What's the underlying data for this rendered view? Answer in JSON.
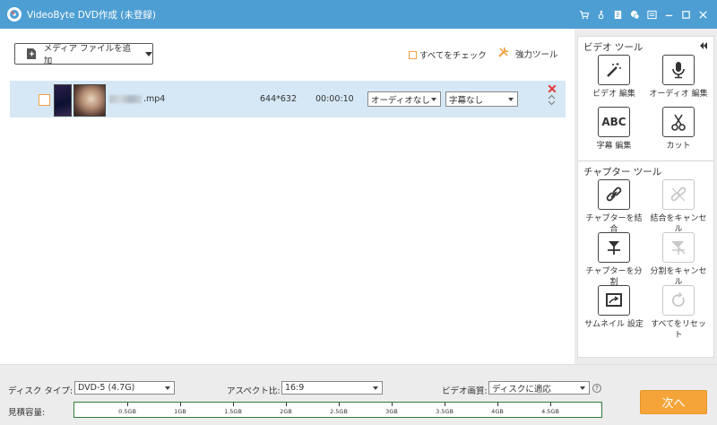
{
  "window": {
    "title": "VideoByte DVD作成 (未登録)",
    "controls": [
      "cart-icon",
      "key-icon",
      "register-icon",
      "feedback-icon",
      "menu-icon",
      "minimize-icon",
      "maximize-icon",
      "close-icon"
    ]
  },
  "toolbar": {
    "add_media_label": "メディア ファイルを追加",
    "check_all_label": "すべてをチェック",
    "power_tools_label": "強力ツール"
  },
  "file": {
    "name_suffix": ".mp4",
    "resolution": "644*632",
    "duration": "00:00:10",
    "audio_track": "オーディオなし",
    "subtitle": "字幕なし"
  },
  "video_tools": {
    "title": "ビデオ ツール",
    "items": [
      {
        "label": "ビデオ 編集",
        "icon": "magic-wand-icon"
      },
      {
        "label": "オーディオ 編集",
        "icon": "microphone-icon"
      },
      {
        "label": "字幕 編集",
        "icon": "abc-icon",
        "icon_text": "ABC"
      },
      {
        "label": "カット",
        "icon": "scissors-icon"
      }
    ]
  },
  "chapter_tools": {
    "title": "チャプター ツール",
    "items": [
      {
        "label": "チャプターを結合",
        "icon": "link-icon",
        "enabled": true
      },
      {
        "label": "結合をキャンセル",
        "icon": "unlink-icon",
        "enabled": false
      },
      {
        "label": "チャプターを分割",
        "icon": "split-icon",
        "enabled": true
      },
      {
        "label": "分割をキャンセル",
        "icon": "cancel-split-icon",
        "enabled": false
      },
      {
        "label": "サムネイル 設定",
        "icon": "thumbnail-icon",
        "enabled": true
      },
      {
        "label": "すべてをリセット",
        "icon": "reset-icon",
        "enabled": false
      }
    ]
  },
  "bottom": {
    "disc_type_label": "ディスク タイプ:",
    "disc_type_value": "DVD-5 (4.7G)",
    "aspect_label": "アスペクト比:",
    "aspect_value": "16:9",
    "quality_label": "ビデオ画質:",
    "quality_value": "ディスクに適応",
    "help_text": "?",
    "capacity_label": "見積容量:",
    "next_label": "次へ",
    "capacity_ticks": [
      "0.5GB",
      "1GB",
      "1.5GB",
      "2GB",
      "2.5GB",
      "3GB",
      "3.5GB",
      "4GB",
      "4.5GB"
    ]
  },
  "colors": {
    "titlebar": "#4d9ed3",
    "accent": "#f5a43a",
    "row_highlight": "#d6e8f6",
    "capacity_border": "#2f7c3a"
  }
}
